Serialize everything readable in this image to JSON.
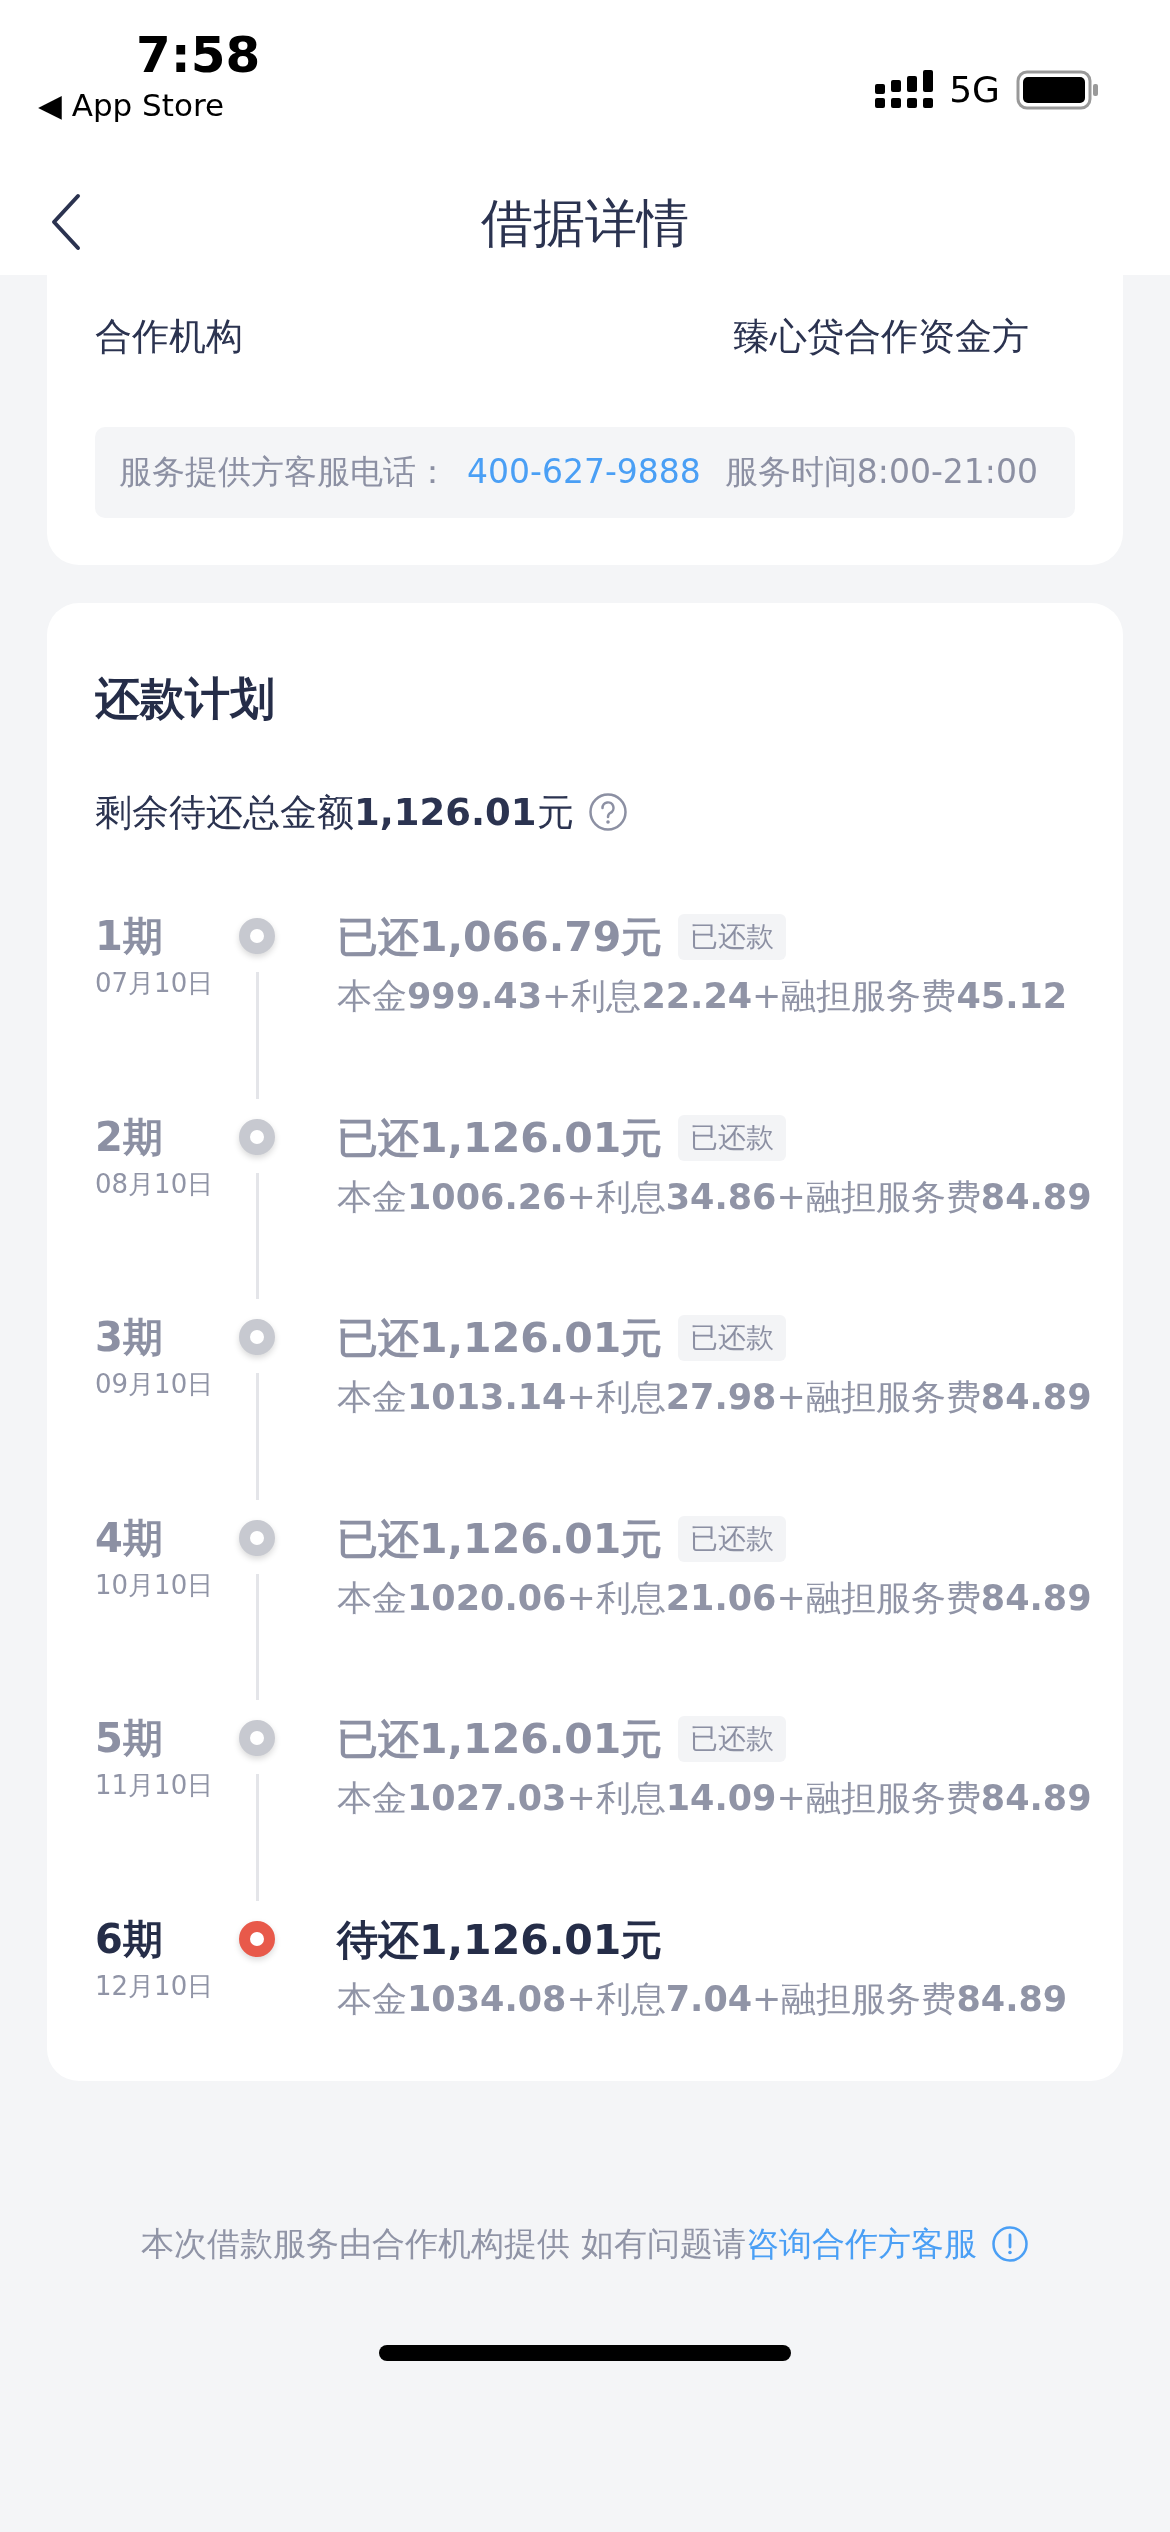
{
  "status_bar": {
    "time": "7:58",
    "back_app": "◀ App Store",
    "network": "5G"
  },
  "nav": {
    "title": "借据详情"
  },
  "institution": {
    "label": "合作机构",
    "value": "臻心贷合作资金方",
    "service_info": {
      "label": "服务提供方客服电话：",
      "phone": "400-627-9888",
      "hours": "服务时间8:00-21:00"
    }
  },
  "plan": {
    "title": "还款计划",
    "remaining": "剩余待还总金额**1,126.01**元",
    "periods": [
      {
        "period": "1期",
        "date": "07月10日",
        "paid": true,
        "amount": "已还1,066.79元",
        "badge": "已还款",
        "breakdown": "本金**999.43**+利息**22.24**+融担服务费**45.12**"
      },
      {
        "period": "2期",
        "date": "08月10日",
        "paid": true,
        "amount": "已还1,126.01元",
        "badge": "已还款",
        "breakdown": "本金**1006.26**+利息**34.86**+融担服务费**84.89**"
      },
      {
        "period": "3期",
        "date": "09月10日",
        "paid": true,
        "amount": "已还1,126.01元",
        "badge": "已还款",
        "breakdown": "本金**1013.14**+利息**27.98**+融担服务费**84.89**"
      },
      {
        "period": "4期",
        "date": "10月10日",
        "paid": true,
        "amount": "已还1,126.01元",
        "badge": "已还款",
        "breakdown": "本金**1020.06**+利息**21.06**+融担服务费**84.89**"
      },
      {
        "period": "5期",
        "date": "11月10日",
        "paid": true,
        "amount": "已还1,126.01元",
        "badge": "已还款",
        "breakdown": "本金**1027.03**+利息**14.09**+融担服务费**84.89**"
      },
      {
        "period": "6期",
        "date": "12月10日",
        "paid": false,
        "amount": "待还1,126.01元",
        "breakdown": "本金**1034.08**+利息**7.04**+融担服务费**84.89**"
      }
    ]
  },
  "footer": {
    "note": "本次借款服务由合作机构提供 如有问题请",
    "link": "咨询合作方客服"
  }
}
